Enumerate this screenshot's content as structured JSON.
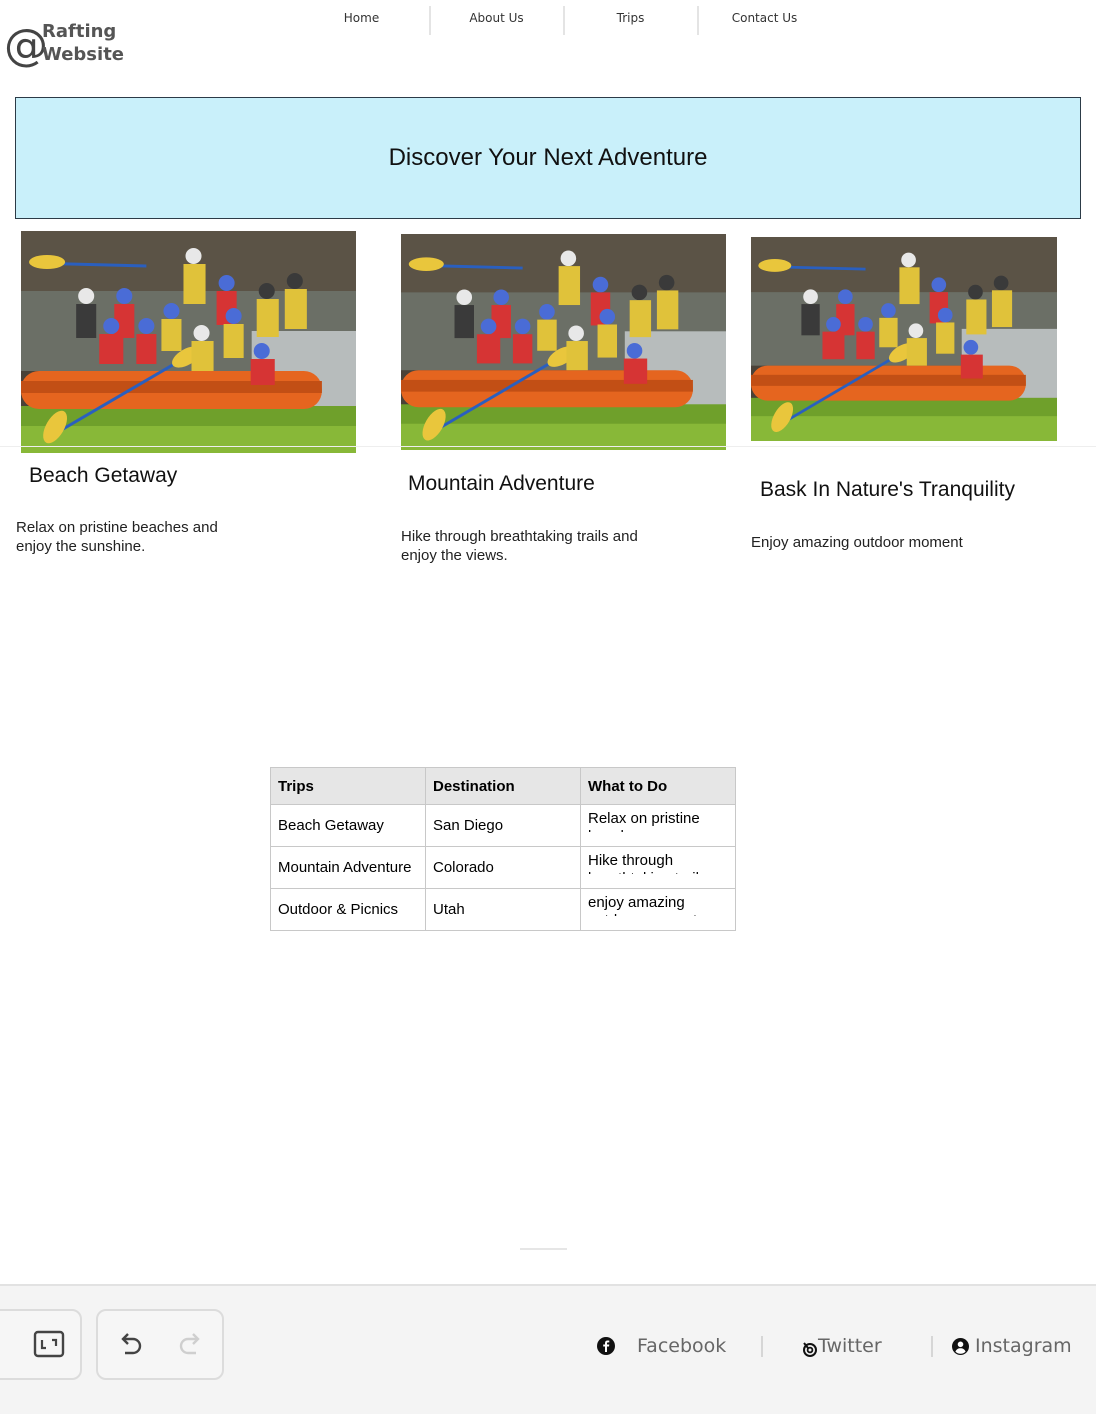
{
  "brand": {
    "logo_glyph": "@",
    "name": "Rafting Website"
  },
  "nav": {
    "items": [
      {
        "label": "Home"
      },
      {
        "label": "About Us"
      },
      {
        "label": "Trips"
      },
      {
        "label": "Contact Us"
      }
    ]
  },
  "hero": {
    "title": "Discover Your Next Adventure"
  },
  "cards": [
    {
      "title": "Beach Getaway",
      "description": "Relax on pristine beaches and enjoy the sunshine.",
      "image": "rafting-group-photo"
    },
    {
      "title": "Mountain Adventure",
      "description": "Hike through breathtaking trails and enjoy the views.",
      "image": "rafting-group-photo"
    },
    {
      "title": "Bask In Nature's Tranquility",
      "description": "Enjoy amazing outdoor moment",
      "image": "rafting-group-photo"
    }
  ],
  "table": {
    "headers": [
      "Trips",
      "Destination",
      "What to Do"
    ],
    "rows": [
      [
        "Beach Getaway",
        "San Diego",
        "Relax on pristine beaches"
      ],
      [
        "Mountain Adventure",
        "Colorado",
        "Hike through breathtaking trail"
      ],
      [
        "Outdoor & Picnics",
        "Utah",
        "enjoy amazing outdoor moment"
      ]
    ]
  },
  "footer": {
    "tools": [
      {
        "icon": "fit-screen-icon"
      },
      {
        "icon": "undo-icon"
      },
      {
        "icon": "redo-icon",
        "disabled": true
      }
    ],
    "social": [
      {
        "label": "Facebook",
        "icon": "facebook-icon"
      },
      {
        "label": "Twitter",
        "icon": "twitter-icon"
      },
      {
        "label": "Instagram",
        "icon": "instagram-icon"
      }
    ]
  },
  "colors": {
    "hero_bg": "#c9f0fa",
    "hero_border": "#2c3b47",
    "table_header_bg": "#e6e6e6",
    "footer_bg": "#f4f4f4"
  }
}
